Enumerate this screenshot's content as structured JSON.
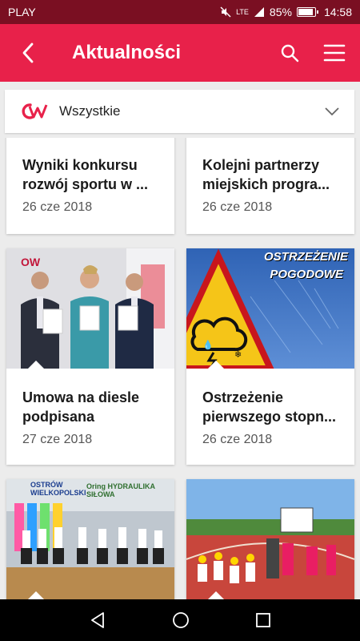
{
  "status_bar": {
    "carrier": "PLAY",
    "network": "LTE",
    "battery": "85%",
    "time": "14:58"
  },
  "app_bar": {
    "title": "Aktualności",
    "back_icon": "back-arrow-icon",
    "search_icon": "search-icon",
    "menu_icon": "hamburger-menu-icon"
  },
  "filter": {
    "label": "Wszystkie",
    "logo_text": "OW"
  },
  "colors": {
    "primary": "#e8214a",
    "status": "#7a0f22",
    "background": "#ececec"
  },
  "cards": [
    {
      "title_line1": "Wyniki konkursu",
      "title_line2": "rozwój sportu w ...",
      "date": "26 cze 2018"
    },
    {
      "title_line1": "Kolejni partnerzy",
      "title_line2": "miejskich progra...",
      "date": "26 cze 2018"
    },
    {
      "title_line1": "Umowa na diesle",
      "title_line2": "podpisana",
      "date": "27 cze 2018",
      "image": "photo-signing"
    },
    {
      "title_line1": "Ostrzeżenie",
      "title_line2": "pierwszego stopn...",
      "date": "26 cze 2018",
      "image": "weather-warning",
      "image_text_1": "OSTRZEŻENIE",
      "image_text_2": "POGODOWE"
    },
    {
      "image": "photo-dance-hall",
      "image_text_1": "OSTRÓW WIELKOPOLSKI",
      "image_text_2": "Oring HYDRAULIKA SIŁOWA"
    },
    {
      "image": "photo-stadium-kids"
    }
  ]
}
